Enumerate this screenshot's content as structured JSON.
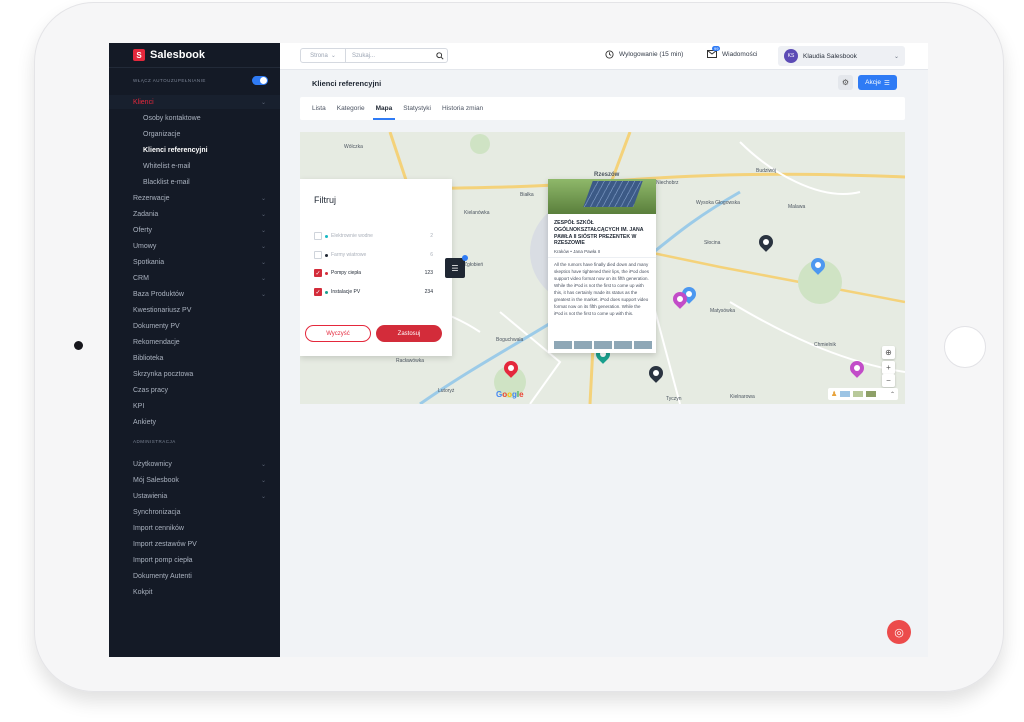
{
  "app": {
    "name": "Salesbook"
  },
  "sidebar": {
    "toggle_label": "Włącz autouzupełnianie",
    "items": [
      {
        "label": "Klienci",
        "active": true,
        "chevron": true
      },
      {
        "label": "Osoby kontaktowe",
        "sub": true
      },
      {
        "label": "Organizacje",
        "sub": true
      },
      {
        "label": "Klienci referencyjni",
        "sub": true,
        "active": true
      },
      {
        "label": "Whitelist e-mail",
        "sub": true
      },
      {
        "label": "Blacklist e-mail",
        "sub": true
      },
      {
        "label": "Rezerwacje",
        "chevron": true
      },
      {
        "label": "Zadania",
        "chevron": true
      },
      {
        "label": "Oferty",
        "chevron": true
      },
      {
        "label": "Umowy",
        "chevron": true
      },
      {
        "label": "Spotkania",
        "chevron": true
      },
      {
        "label": "CRM",
        "chevron": true
      },
      {
        "label": "Baza Produktów",
        "chevron": true
      },
      {
        "label": "Kwestionariusz PV"
      },
      {
        "label": "Dokumenty PV"
      },
      {
        "label": "Rekomendacje"
      },
      {
        "label": "Biblioteka"
      },
      {
        "label": "Skrzynka pocztowa"
      },
      {
        "label": "Czas pracy"
      },
      {
        "label": "KPI"
      },
      {
        "label": "Ankiety"
      }
    ],
    "admin_label": "Administracja",
    "admin_items": [
      {
        "label": "Użytkownicy",
        "chevron": true
      },
      {
        "label": "Mój Salesbook",
        "chevron": true
      },
      {
        "label": "Ustawienia",
        "chevron": true
      },
      {
        "label": "Synchronizacja"
      },
      {
        "label": "Import cenników"
      },
      {
        "label": "Import zestawów PV"
      },
      {
        "label": "Import pomp ciepła"
      },
      {
        "label": "Dokumenty Autenti"
      },
      {
        "label": "Kokpit"
      }
    ]
  },
  "topbar": {
    "search_scope": "Strona",
    "search_placeholder": "Szukaj...",
    "logout_label": "Wylogowanie (15 min)",
    "messages_label": "Wiadomości",
    "messages_badge": "99",
    "user_initials": "KS",
    "user_name": "Klaudia Salesbook"
  },
  "page": {
    "title": "Klienci referencyjni",
    "actions_label": "Akcje"
  },
  "tabs": [
    {
      "label": "Lista"
    },
    {
      "label": "Kategorie"
    },
    {
      "label": "Mapa",
      "active": true
    },
    {
      "label": "Statystyki"
    },
    {
      "label": "Historia zmian"
    }
  ],
  "filter": {
    "title": "Filtruj",
    "options": [
      {
        "label": "Elektrownie wodne",
        "count": "2",
        "checked": false,
        "color": "#17b8c4"
      },
      {
        "label": "Farmy wiatrowe",
        "count": "6",
        "checked": false,
        "color": "#1f2733"
      },
      {
        "label": "Pompy ciepła",
        "count": "123",
        "checked": true,
        "color": "#d32c3a"
      },
      {
        "label": "Instalacje PV",
        "count": "234",
        "checked": true,
        "color": "#19a08e"
      }
    ],
    "clear_label": "Wyczyść",
    "apply_label": "Zastosuj"
  },
  "popup": {
    "title": "ZESPÓŁ SZKÓŁ OGÓLNOKSZTAŁCĄCYCH IM. JANA PAWŁA II SIÓSTR PREZENTEK W RZESZOWIE",
    "address": "Kraków • Jana Pawła II",
    "description": "All the rumors have finally died down and many skeptics have tightened their lips, the iPod does support video format now on its fifth generation. While the iPod is not the first to come up with this, it has certainly made its status as the greatest in the market. iPod does support video format now on its fifth generation. While the iPod is not the first to come up with this."
  },
  "map": {
    "labels": [
      "Wólczka",
      "Rzeszów",
      "Kielanówka",
      "Malawa",
      "Boguchwała",
      "Matysówka",
      "Chmielnik",
      "Lutoryż",
      "Tyczyn",
      "Kielnarowa",
      "Słocina",
      "Zgłobień",
      "Racławówka",
      "Niechobrz",
      "Budziwój",
      "Białka",
      "Wysoka Głogowska"
    ],
    "google": "Google"
  }
}
